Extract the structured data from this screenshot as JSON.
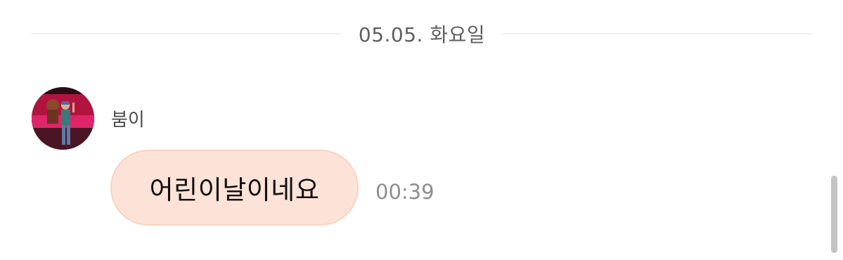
{
  "date_divider": {
    "label": "05.05. 화요일"
  },
  "message": {
    "sender": "붐이",
    "text": "어린이날이네요",
    "time": "00:39",
    "avatar_icon": "profile-photo"
  },
  "colors": {
    "bubble_fill": "#fde3d7",
    "bubble_border": "#f9d2bf",
    "divider_line": "#f1f2f6",
    "time_text": "#8e8e8e"
  }
}
